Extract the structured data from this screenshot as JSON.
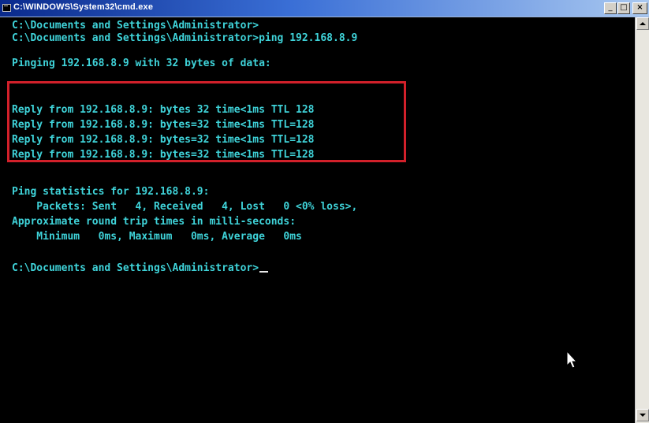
{
  "window": {
    "title": "C:\\WINDOWS\\System32\\cmd.exe",
    "controls": {
      "minimize": "_",
      "maximize": "□",
      "close": "×"
    }
  },
  "console": {
    "lines": [
      "C:\\Documents and Settings\\Administrator>",
      "C:\\Documents and Settings\\Administrator>ping 192.168.8.9",
      "",
      "Pinging 192.168.8.9 with 32 bytes of data:",
      "",
      "Reply from 192.168.8.9: bytes 32 time<1ms TTL 128",
      "Reply from 192.168.8.9: bytes=32 time<1ms TTL=128",
      "Reply from 192.168.8.9: bytes=32 time<1ms TTL=128",
      "Reply from 192.168.8.9: bytes=32 time<1ms TTL=128",
      "",
      "Ping statistics for 192.168.8.9:",
      "    Packets: Sent   4, Received   4, Lost   0 <0% loss>,",
      "Approximate round trip times in milli-seconds:",
      "    Minimum   0ms, Maximum   0ms, Average   0ms",
      "",
      "C:\\Documents and Settings\\Administrator>"
    ]
  },
  "colors": {
    "console_text": "#3fd3d9",
    "console_background": "#000000",
    "highlight_border": "#d2202a",
    "titlebar_start": "#0a2a8c",
    "titlebar_end": "#a9c8f0"
  },
  "icons": {
    "window_icon": "cmd-icon",
    "pointer": "mouse-pointer-icon"
  }
}
